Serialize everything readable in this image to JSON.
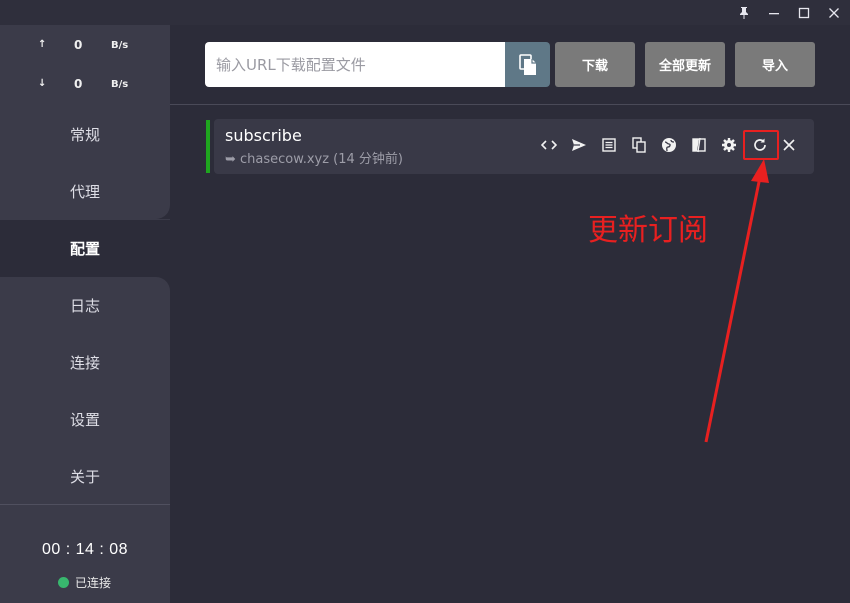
{
  "titlebar": {
    "icons": [
      "pin-icon",
      "minimize-icon",
      "maximize-icon",
      "close-icon"
    ]
  },
  "sidebar": {
    "upload": {
      "arrow": "↑",
      "value": "0",
      "unit": "B/s"
    },
    "download": {
      "arrow": "↓",
      "value": "0",
      "unit": "B/s"
    },
    "nav": [
      {
        "label": "常规"
      },
      {
        "label": "代理"
      },
      {
        "label": "配置",
        "active": true
      },
      {
        "label": "日志"
      },
      {
        "label": "连接"
      },
      {
        "label": "设置"
      },
      {
        "label": "关于"
      }
    ],
    "timer": "00 : 14 : 08",
    "status": "已连接",
    "status_color": "#38b76e"
  },
  "toolbar": {
    "url_placeholder": "输入URL下载配置文件",
    "download_label": "下载",
    "update_all_label": "全部更新",
    "import_label": "导入"
  },
  "profile": {
    "name": "subscribe",
    "source": "➥ chasecow.xyz (14 分钟前)",
    "active_color": "#1fa51f",
    "actions": [
      "code-icon",
      "send-icon",
      "list-icon",
      "copy-icon",
      "globe-icon",
      "split-icon",
      "gear-icon",
      "refresh-icon",
      "close-icon"
    ]
  },
  "annotation": {
    "text": "更新订阅",
    "color": "#e82020"
  }
}
